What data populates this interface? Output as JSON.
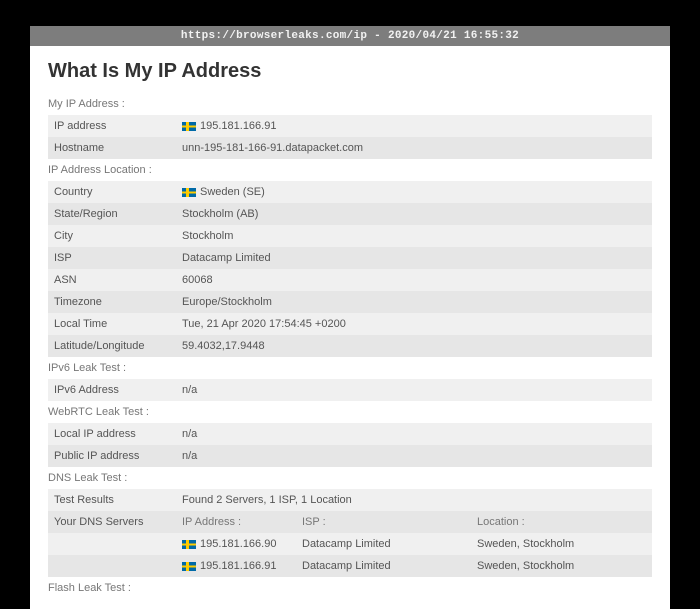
{
  "window": {
    "title": "https://browserleaks.com/ip - 2020/04/21 16:55:32"
  },
  "heading": "What Is My IP Address",
  "sections": {
    "my_ip": {
      "title": "My IP Address :",
      "ip_label": "IP address",
      "ip_value": "195.181.166.91",
      "hostname_label": "Hostname",
      "hostname_value": "unn-195-181-166-91.datapacket.com"
    },
    "location": {
      "title": "IP Address Location :",
      "country_label": "Country",
      "country_value": "Sweden (SE)",
      "state_label": "State/Region",
      "state_value": "Stockholm (AB)",
      "city_label": "City",
      "city_value": "Stockholm",
      "isp_label": "ISP",
      "isp_value": "Datacamp Limited",
      "asn_label": "ASN",
      "asn_value": "60068",
      "tz_label": "Timezone",
      "tz_value": "Europe/Stockholm",
      "localtime_label": "Local Time",
      "localtime_value": "Tue, 21 Apr 2020 17:54:45 +0200",
      "latlon_label": "Latitude/Longitude",
      "latlon_value": "59.4032,17.9448"
    },
    "ipv6": {
      "title": "IPv6 Leak Test :",
      "label": "IPv6 Address",
      "value": "n/a"
    },
    "webrtc": {
      "title": "WebRTC Leak Test :",
      "local_label": "Local IP address",
      "local_value": "n/a",
      "public_label": "Public IP address",
      "public_value": "n/a"
    },
    "dns": {
      "title": "DNS Leak Test :",
      "results_label": "Test Results",
      "results_value": "Found 2 Servers, 1 ISP, 1 Location",
      "servers_label": "Your DNS Servers",
      "col_ip": "IP Address :",
      "col_isp": "ISP :",
      "col_location": "Location :",
      "rows": [
        {
          "ip": "195.181.166.90",
          "isp": "Datacamp Limited",
          "location": "Sweden, Stockholm"
        },
        {
          "ip": "195.181.166.91",
          "isp": "Datacamp Limited",
          "location": "Sweden, Stockholm"
        }
      ]
    },
    "flash": {
      "title": "Flash Leak Test :"
    }
  }
}
